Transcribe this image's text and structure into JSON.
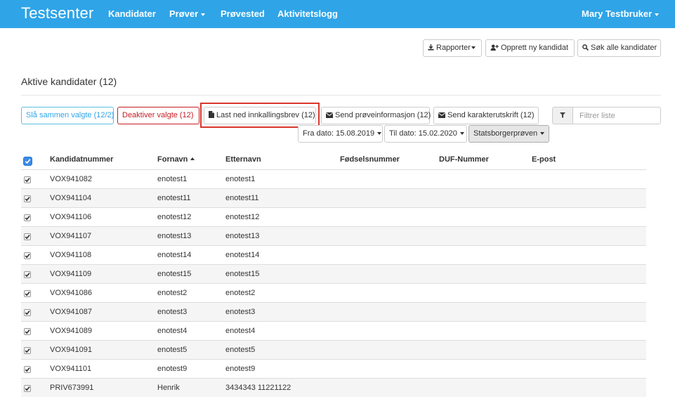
{
  "navbar": {
    "brand": "Testsenter",
    "links": [
      "Kandidater",
      "Prøver",
      "Prøvested",
      "Aktivitetslogg"
    ],
    "user": "Mary Testbruker"
  },
  "toolbar": {
    "reports": "Rapporter",
    "create_candidate": "Opprett ny kandidat",
    "search_all": "Søk alle kandidater"
  },
  "page": {
    "title": "Aktive kandidater (12)"
  },
  "actions": {
    "merge": "Slå sammen valgte (12/2)",
    "deactivate": "Deaktiver valgte (12)",
    "download_letter": "Last ned innkallingsbrev (12)",
    "send_info": "Send prøveinformasjon (12)",
    "send_transcript": "Send karakterutskrift (12)",
    "filter_placeholder": "Filtrer liste"
  },
  "filters": {
    "from_date": "Fra dato: 15.08.2019",
    "to_date": "Til dato: 15.02.2020",
    "test_type": "Statsborgerprøven"
  },
  "table": {
    "headers": [
      "Kandidatnummer",
      "Fornavn",
      "Etternavn",
      "Fødselsnummer",
      "DUF-Nummer",
      "E-post"
    ],
    "rows": [
      {
        "number": "VOX941082",
        "first": "enotest1",
        "last": "enotest1"
      },
      {
        "number": "VOX941104",
        "first": "enotest11",
        "last": "enotest11"
      },
      {
        "number": "VOX941106",
        "first": "enotest12",
        "last": "enotest12"
      },
      {
        "number": "VOX941107",
        "first": "enotest13",
        "last": "enotest13"
      },
      {
        "number": "VOX941108",
        "first": "enotest14",
        "last": "enotest14"
      },
      {
        "number": "VOX941109",
        "first": "enotest15",
        "last": "enotest15"
      },
      {
        "number": "VOX941086",
        "first": "enotest2",
        "last": "enotest2"
      },
      {
        "number": "VOX941087",
        "first": "enotest3",
        "last": "enotest3"
      },
      {
        "number": "VOX941089",
        "first": "enotest4",
        "last": "enotest4"
      },
      {
        "number": "VOX941091",
        "first": "enotest5",
        "last": "enotest5"
      },
      {
        "number": "VOX941101",
        "first": "enotest9",
        "last": "enotest9"
      },
      {
        "number": "PRIV673991",
        "first": "Henrik",
        "last": "3434343 11221122"
      }
    ]
  },
  "colors": {
    "navbar": "#2fa4e7",
    "danger": "#c71c22",
    "highlight": "#d9362b"
  }
}
